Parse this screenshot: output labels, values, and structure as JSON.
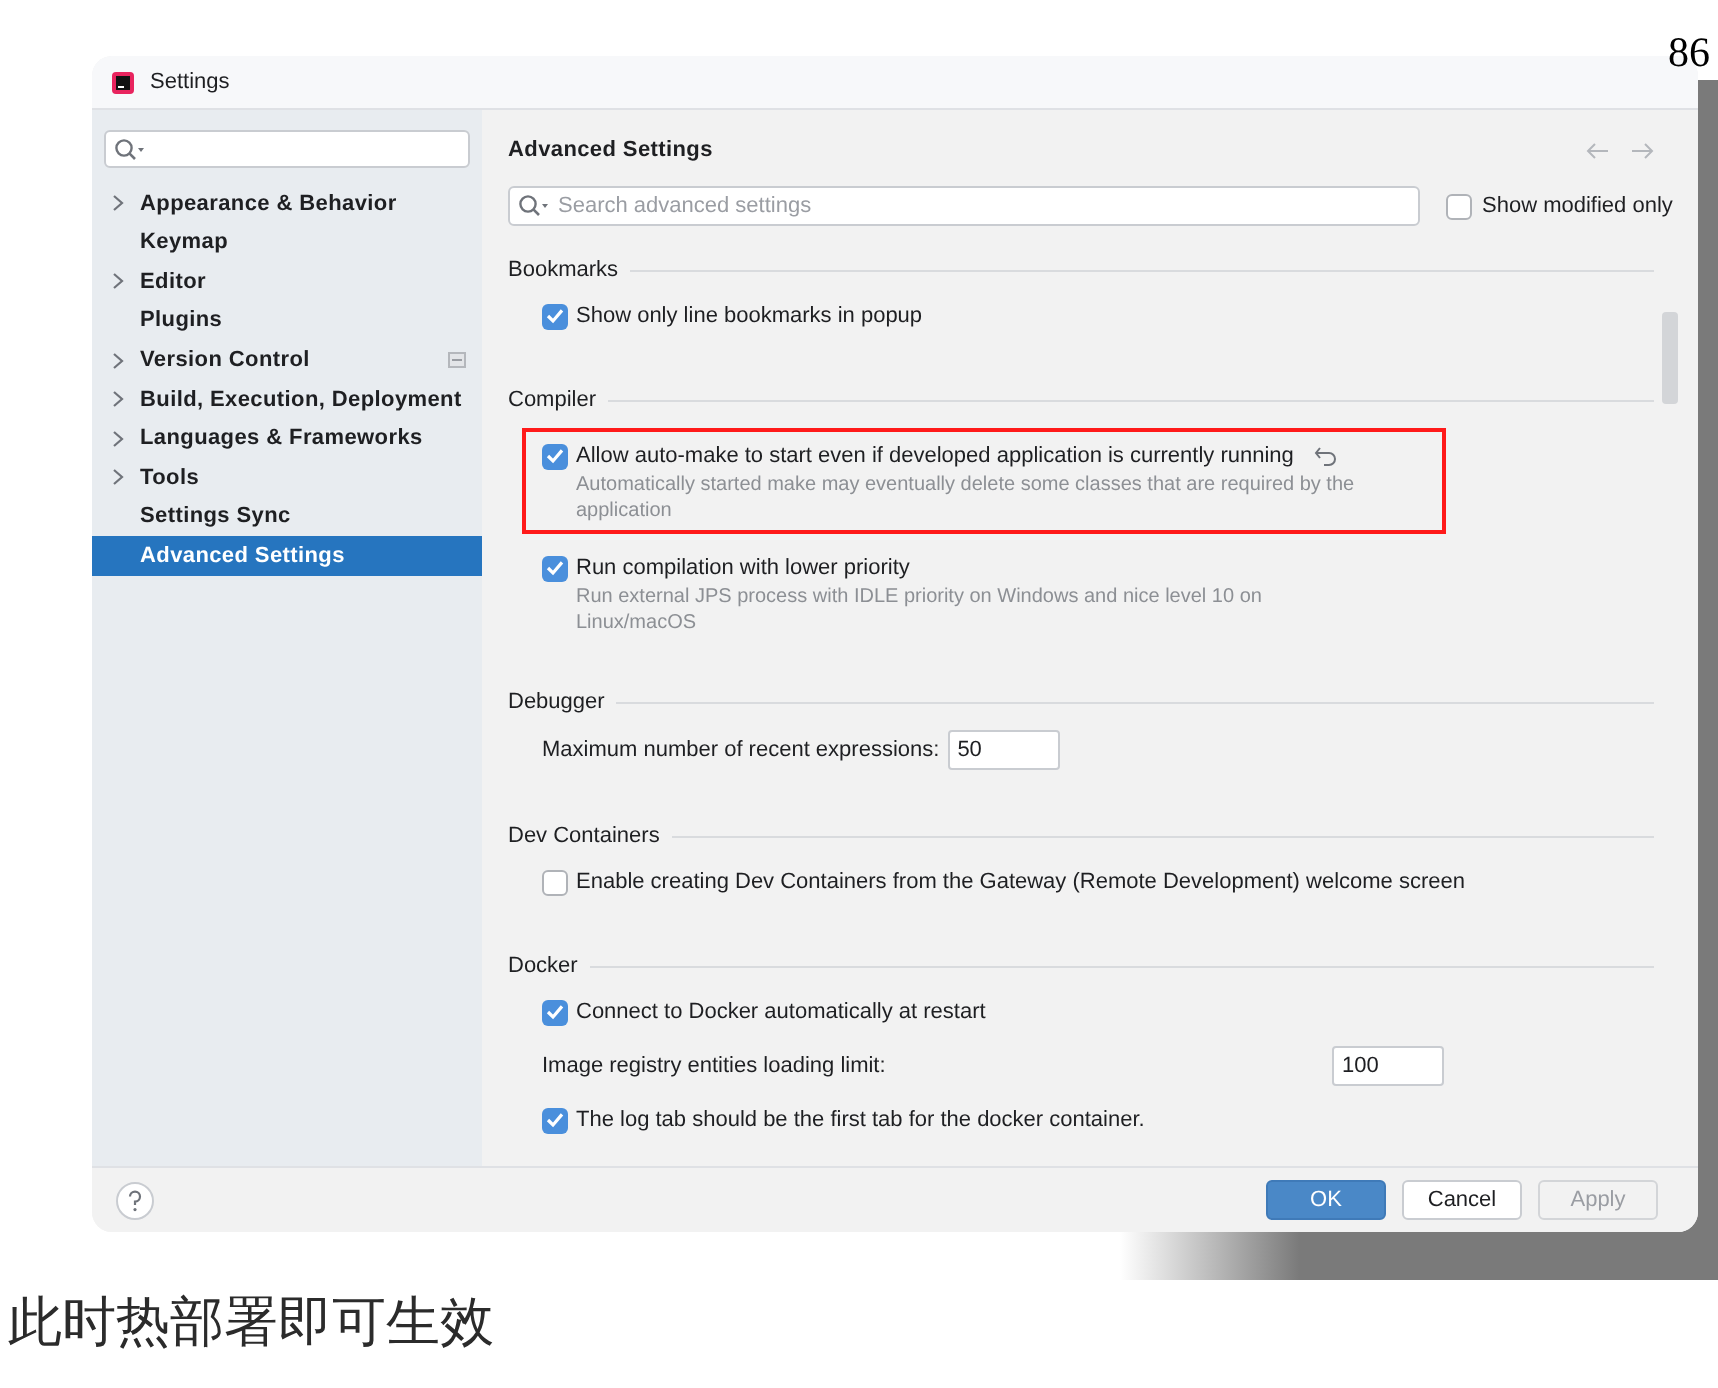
{
  "page_number": "86",
  "window": {
    "title": "Settings"
  },
  "sidebar": {
    "items": [
      {
        "label": "Appearance & Behavior",
        "expandable": true,
        "selected": false,
        "marked": false
      },
      {
        "label": "Keymap",
        "expandable": false,
        "selected": false,
        "marked": false
      },
      {
        "label": "Editor",
        "expandable": true,
        "selected": false,
        "marked": false
      },
      {
        "label": "Plugins",
        "expandable": false,
        "selected": false,
        "marked": false
      },
      {
        "label": "Version Control",
        "expandable": true,
        "selected": false,
        "marked": true
      },
      {
        "label": "Build, Execution, Deployment",
        "expandable": true,
        "selected": false,
        "marked": false
      },
      {
        "label": "Languages & Frameworks",
        "expandable": true,
        "selected": false,
        "marked": false
      },
      {
        "label": "Tools",
        "expandable": true,
        "selected": false,
        "marked": false
      },
      {
        "label": "Settings Sync",
        "expandable": false,
        "selected": false,
        "marked": false
      },
      {
        "label": "Advanced Settings",
        "expandable": false,
        "selected": true,
        "marked": false
      }
    ]
  },
  "main": {
    "title": "Advanced Settings",
    "search": {
      "placeholder": "Search advanced settings"
    },
    "show_modified": {
      "label": "Show modified only",
      "checked": false
    },
    "sections": [
      {
        "title": "Bookmarks",
        "settings": [
          {
            "kind": "checkbox",
            "label": "Show only line bookmarks in popup",
            "checked": true,
            "modified": false,
            "highlighted": false
          }
        ]
      },
      {
        "title": "Compiler",
        "settings": [
          {
            "kind": "checkbox",
            "label": "Allow auto-make to start even if developed application is currently running",
            "checked": true,
            "modified": true,
            "highlighted": true,
            "description": "Automatically started make may eventually delete some classes that are required by the application"
          },
          {
            "kind": "checkbox",
            "label": "Run compilation with lower priority",
            "checked": true,
            "modified": false,
            "highlighted": false,
            "description": "Run external JPS process with IDLE priority on Windows and nice level 10 on Linux/macOS"
          }
        ]
      },
      {
        "title": "Debugger",
        "settings": [
          {
            "kind": "number_inline",
            "label": "Maximum number of recent expressions:",
            "value": "50",
            "highlighted": false
          }
        ]
      },
      {
        "title": "Dev Containers",
        "settings": [
          {
            "kind": "checkbox",
            "label": "Enable creating Dev Containers from the Gateway (Remote Development) welcome screen",
            "checked": false,
            "modified": false,
            "highlighted": false
          }
        ]
      },
      {
        "title": "Docker",
        "settings": [
          {
            "kind": "checkbox",
            "label": "Connect to Docker automatically at restart",
            "checked": true,
            "modified": false,
            "highlighted": false
          },
          {
            "kind": "number_right",
            "label": "Image registry entities loading limit:",
            "value": "100",
            "highlighted": false
          },
          {
            "kind": "checkbox",
            "label": "The log tab should be the first tab for the docker container.",
            "checked": true,
            "modified": false,
            "highlighted": false
          }
        ]
      }
    ]
  },
  "footer": {
    "buttons": [
      {
        "label": "OK",
        "kind": "primary"
      },
      {
        "label": "Cancel",
        "kind": "default"
      },
      {
        "label": "Apply",
        "kind": "disabled"
      }
    ]
  },
  "caption": "此时热部署即可生效"
}
